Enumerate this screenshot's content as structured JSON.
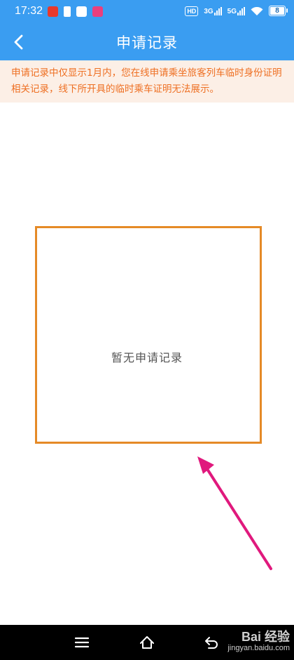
{
  "status_bar": {
    "time": "17:32",
    "left_icons": [
      "news-app-icon",
      "battery-saver-icon",
      "browser-app-icon",
      "shopping-app-icon"
    ],
    "hd_label": "HD",
    "network_1": "3G",
    "network_2": "5G",
    "battery_level": "8"
  },
  "header": {
    "back_icon": "chevron-left-icon",
    "title": "申请记录"
  },
  "notice": {
    "text": "申请记录中仅显示1月内，您在线申请乘坐旅客列车临时身份证明相关记录，线下所开具的临时乘车证明无法展示。"
  },
  "empty_state": {
    "text": "暂无申请记录"
  },
  "bottom_nav": {
    "icons": [
      "menu-icon",
      "home-icon",
      "back-icon"
    ]
  },
  "watermark": {
    "brand": "Bai 经验",
    "site": "jingyan.baidu.com"
  },
  "colors": {
    "header_bg": "#3a9df1",
    "notice_bg": "#fcefe6",
    "notice_text": "#ee6f22",
    "annotation_box": "#e58a27",
    "annotation_arrow": "#e0197d"
  }
}
